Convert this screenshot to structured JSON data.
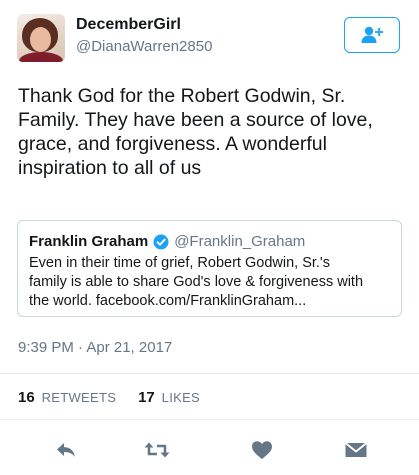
{
  "author": {
    "display_name": "DecemberGirl",
    "handle": "@DianaWarren2850"
  },
  "tweet": {
    "text_lines": [
      "Thank God for the Robert Godwin, Sr.",
      "Family.  They have been a source of love,",
      "grace, and forgiveness.  A wonderful",
      "inspiration to all of us"
    ],
    "timestamp": "9:39 PM · Apr 21, 2017"
  },
  "quoted_tweet": {
    "display_name": "Franklin Graham",
    "handle": "@Franklin_Graham",
    "text_lines": [
      "Even in their time of grief, Robert Godwin, Sr.'s",
      "family is able to share God's love & forgiveness with",
      "the world. facebook.com/FranklinGraham..."
    ]
  },
  "stats": {
    "retweets_count": "16",
    "retweets_label": "RETWEETS",
    "likes_count": "17",
    "likes_label": "LIKES"
  },
  "icons": {
    "follow": "add-user-icon",
    "verified": "verified-badge-icon",
    "reply": "reply-icon",
    "retweet": "retweet-icon",
    "like": "heart-icon",
    "message": "envelope-icon"
  },
  "colors": {
    "accent": "#1da1f2",
    "secondary_text": "#657786",
    "icon_gray": "#657786",
    "border": "#ccd6dd"
  }
}
